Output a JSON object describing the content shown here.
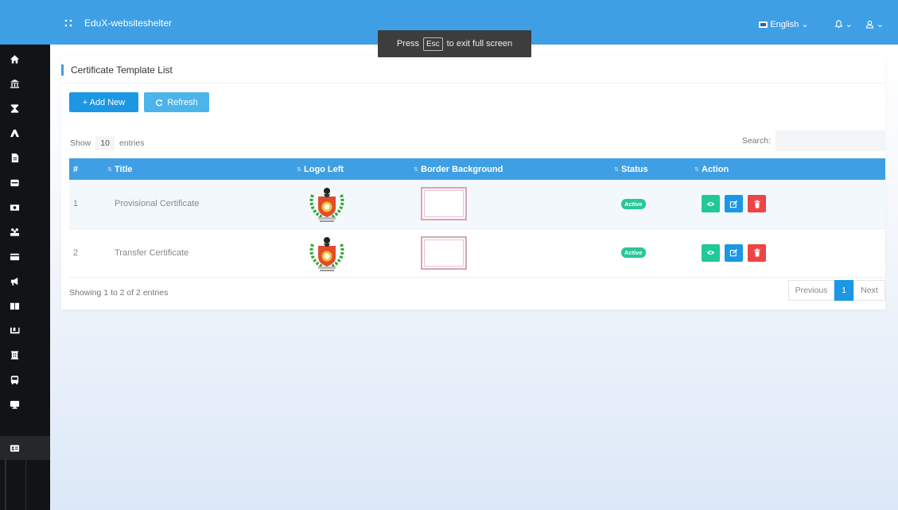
{
  "topbar": {
    "app_name": "EduX-websiteshelter",
    "language": "English"
  },
  "fullscreen_notice": {
    "prefix": "Press",
    "key": "Esc",
    "suffix": "to exit full screen"
  },
  "sidebar": {
    "items": [
      {
        "icon": "home-icon"
      },
      {
        "icon": "bank-icon"
      },
      {
        "icon": "hourglass-icon"
      },
      {
        "icon": "road-icon"
      },
      {
        "icon": "file-icon"
      },
      {
        "icon": "wallet-icon"
      },
      {
        "icon": "money-icon"
      },
      {
        "icon": "users-icon"
      },
      {
        "icon": "credit-card-icon"
      },
      {
        "icon": "megaphone-icon"
      },
      {
        "icon": "book-icon"
      },
      {
        "icon": "truck-icon"
      },
      {
        "icon": "building-icon"
      },
      {
        "icon": "bus-icon"
      },
      {
        "icon": "desktop-icon"
      },
      {
        "icon": "id-card-icon"
      }
    ],
    "active_index": 15
  },
  "card": {
    "title": "Certificate Template List",
    "add_label": "+ Add New",
    "refresh_label": "Refresh",
    "show_label": "Show",
    "entries_value": "10",
    "entries_label": "entries",
    "search_label": "Search:",
    "search_value": ""
  },
  "table": {
    "columns": [
      "#",
      "Title",
      "Logo Left",
      "Border Background",
      "Status",
      "Action"
    ],
    "rows": [
      {
        "num": "1",
        "title": "Provisional Certificate",
        "status": "Active"
      },
      {
        "num": "2",
        "title": "Transfer Certificate",
        "status": "Active"
      }
    ]
  },
  "footer": {
    "info": "Showing 1 to 2 of 2 entries",
    "prev": "Previous",
    "page": "1",
    "next": "Next"
  },
  "colors": {
    "primary": "#3f9fe4",
    "sidebar": "#111314",
    "success": "#27c79a",
    "danger": "#ef4444"
  }
}
